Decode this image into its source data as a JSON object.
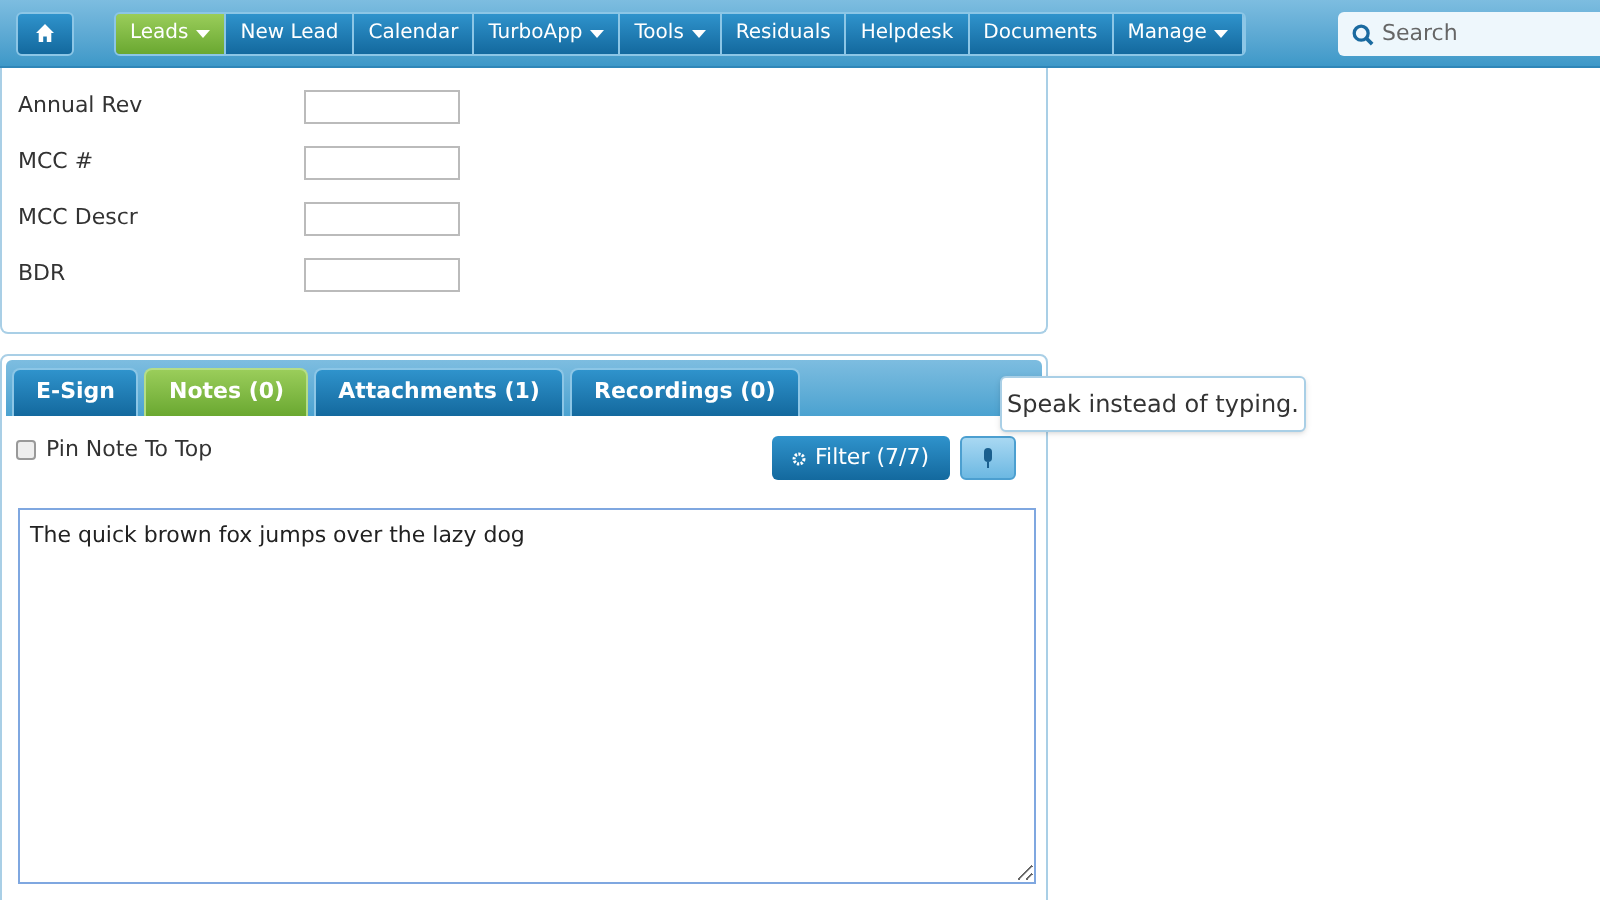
{
  "nav": {
    "items": [
      {
        "label": "Leads",
        "selected": true,
        "dropdown": true
      },
      {
        "label": "New Lead",
        "selected": false,
        "dropdown": false
      },
      {
        "label": "Calendar",
        "selected": false,
        "dropdown": false
      },
      {
        "label": "TurboApp",
        "selected": false,
        "dropdown": true
      },
      {
        "label": "Tools",
        "selected": false,
        "dropdown": true
      },
      {
        "label": "Residuals",
        "selected": false,
        "dropdown": false
      },
      {
        "label": "Helpdesk",
        "selected": false,
        "dropdown": false
      },
      {
        "label": "Documents",
        "selected": false,
        "dropdown": false
      },
      {
        "label": "Manage",
        "selected": false,
        "dropdown": true
      }
    ],
    "search": {
      "placeholder": "Search"
    }
  },
  "form": {
    "fields": [
      {
        "label": "Annual Rev"
      },
      {
        "label": "MCC #"
      },
      {
        "label": "MCC Descr"
      },
      {
        "label": "BDR"
      }
    ]
  },
  "notes": {
    "tabs": [
      {
        "label": "E-Sign",
        "selected": false
      },
      {
        "label": "Notes (0)",
        "selected": true
      },
      {
        "label": "Attachments (1)",
        "selected": false
      },
      {
        "label": "Recordings (0)",
        "selected": false
      }
    ],
    "pin": {
      "label": "Pin Note To Top",
      "checked": false
    },
    "filter": "Filter (7/7)",
    "tooltip": "Speak instead of typing.",
    "note_text": "The quick brown fox jumps over the lazy dog"
  }
}
